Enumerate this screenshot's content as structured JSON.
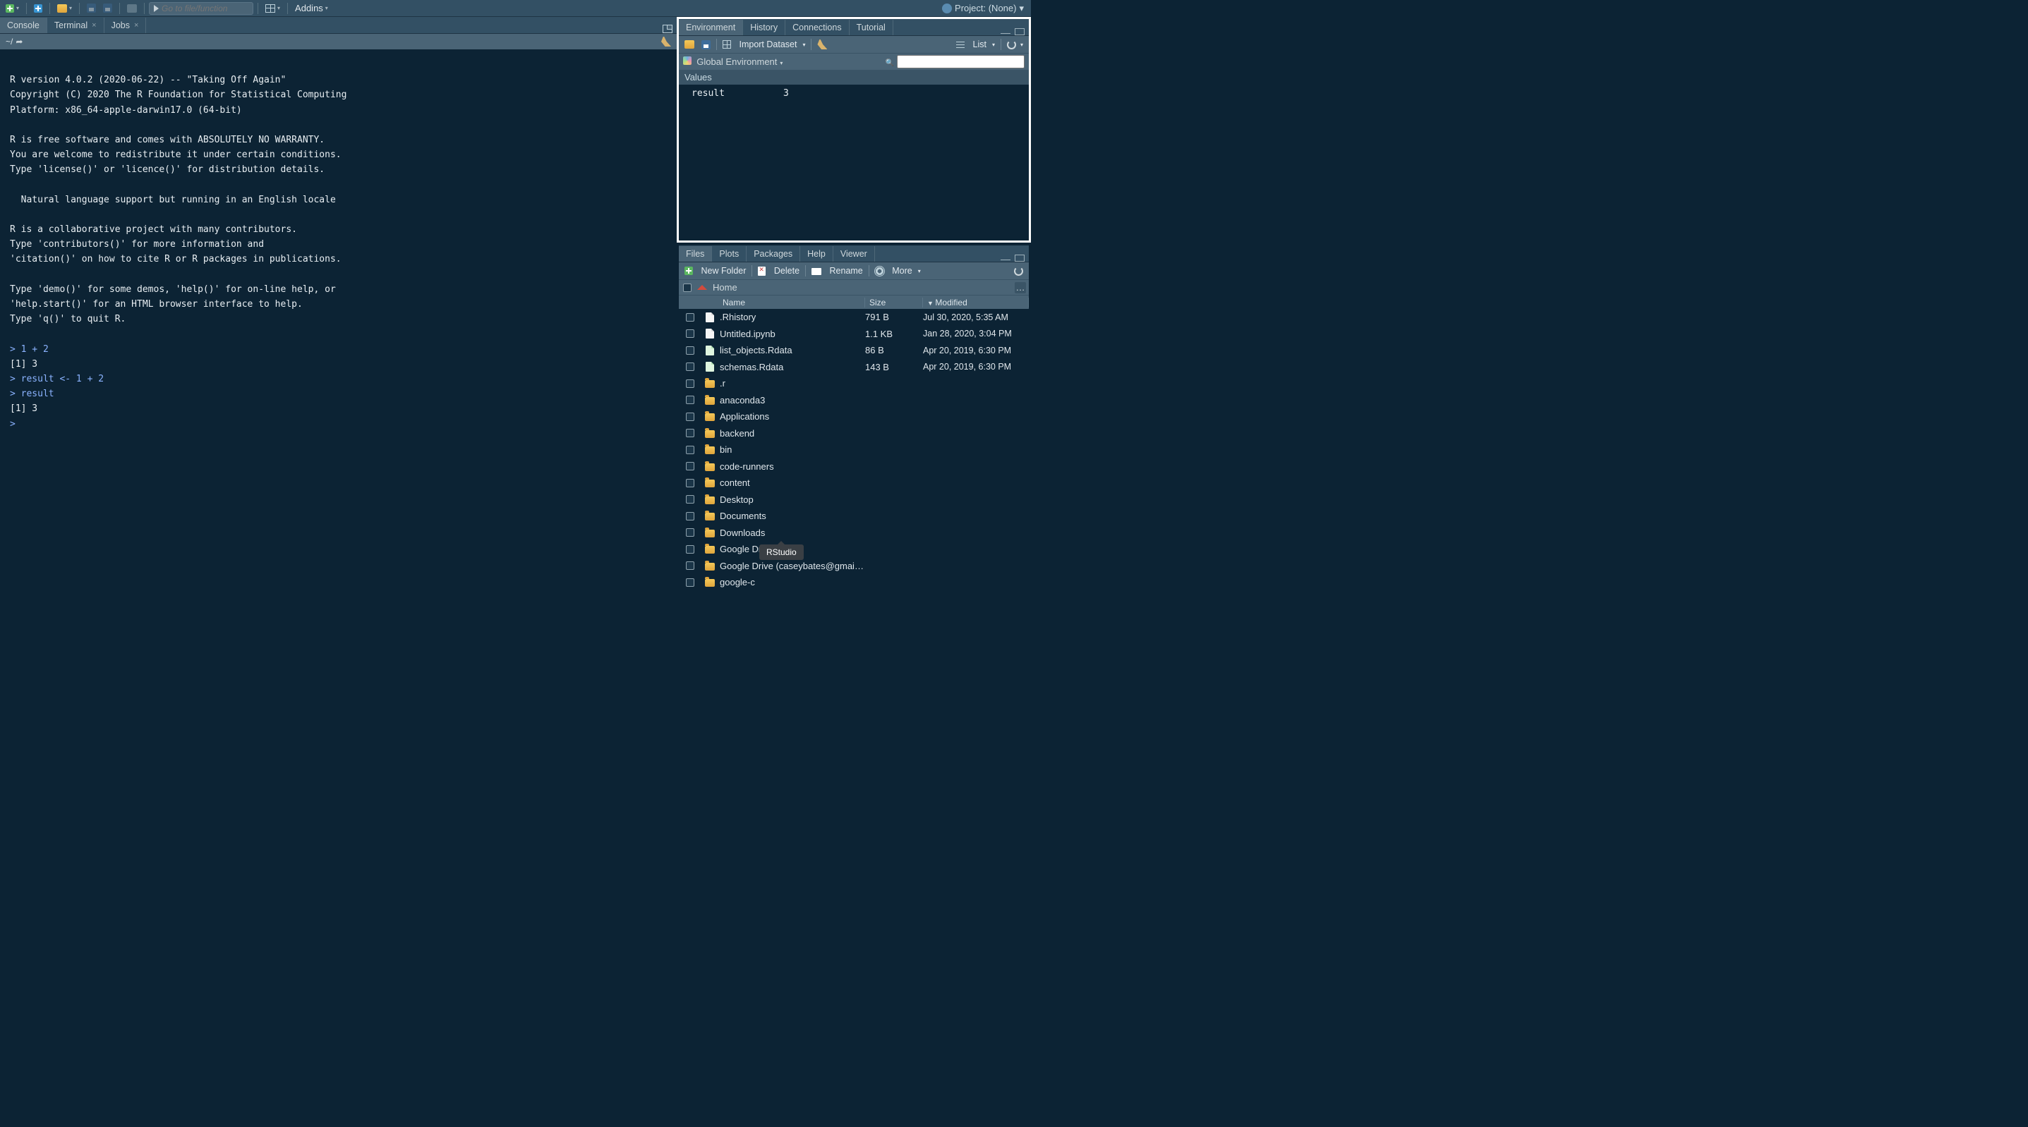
{
  "toolbar": {
    "goto_placeholder": "Go to file/function",
    "addins_label": "Addins",
    "project_label": "Project: (None)"
  },
  "left_tabs": [
    {
      "label": "Console",
      "closable": false,
      "active": true
    },
    {
      "label": "Terminal",
      "closable": true,
      "active": false
    },
    {
      "label": "Jobs",
      "closable": true,
      "active": false
    }
  ],
  "console": {
    "path": "~/",
    "lines": [
      {
        "t": "plain",
        "text": ""
      },
      {
        "t": "plain",
        "text": "R version 4.0.2 (2020-06-22) -- \"Taking Off Again\""
      },
      {
        "t": "plain",
        "text": "Copyright (C) 2020 The R Foundation for Statistical Computing"
      },
      {
        "t": "plain",
        "text": "Platform: x86_64-apple-darwin17.0 (64-bit)"
      },
      {
        "t": "plain",
        "text": ""
      },
      {
        "t": "plain",
        "text": "R is free software and comes with ABSOLUTELY NO WARRANTY."
      },
      {
        "t": "plain",
        "text": "You are welcome to redistribute it under certain conditions."
      },
      {
        "t": "plain",
        "text": "Type 'license()' or 'licence()' for distribution details."
      },
      {
        "t": "plain",
        "text": ""
      },
      {
        "t": "plain",
        "text": "  Natural language support but running in an English locale"
      },
      {
        "t": "plain",
        "text": ""
      },
      {
        "t": "plain",
        "text": "R is a collaborative project with many contributors."
      },
      {
        "t": "plain",
        "text": "Type 'contributors()' for more information and"
      },
      {
        "t": "plain",
        "text": "'citation()' on how to cite R or R packages in publications."
      },
      {
        "t": "plain",
        "text": ""
      },
      {
        "t": "plain",
        "text": "Type 'demo()' for some demos, 'help()' for on-line help, or"
      },
      {
        "t": "plain",
        "text": "'help.start()' for an HTML browser interface to help."
      },
      {
        "t": "plain",
        "text": "Type 'q()' to quit R."
      },
      {
        "t": "plain",
        "text": ""
      },
      {
        "t": "input",
        "text": "> 1 + 2"
      },
      {
        "t": "plain",
        "text": "[1] 3"
      },
      {
        "t": "input",
        "text": "> result <- 1 + 2"
      },
      {
        "t": "input",
        "text": "> result"
      },
      {
        "t": "plain",
        "text": "[1] 3"
      },
      {
        "t": "input",
        "text": "> "
      }
    ]
  },
  "env": {
    "tabs": [
      {
        "label": "Environment",
        "active": true
      },
      {
        "label": "History",
        "active": false
      },
      {
        "label": "Connections",
        "active": false
      },
      {
        "label": "Tutorial",
        "active": false
      }
    ],
    "toolbar": {
      "import_label": "Import Dataset",
      "view_label": "List"
    },
    "scope_label": "Global Environment",
    "section_label": "Values",
    "rows": [
      {
        "name": "result",
        "value": "3"
      }
    ]
  },
  "files": {
    "tabs": [
      {
        "label": "Files",
        "active": true
      },
      {
        "label": "Plots",
        "active": false
      },
      {
        "label": "Packages",
        "active": false
      },
      {
        "label": "Help",
        "active": false
      },
      {
        "label": "Viewer",
        "active": false
      }
    ],
    "toolbar": {
      "new_folder": "New Folder",
      "delete": "Delete",
      "rename": "Rename",
      "more": "More"
    },
    "breadcrumb": "Home",
    "columns": {
      "name": "Name",
      "size": "Size",
      "modified": "Modified"
    },
    "rows": [
      {
        "icon": "file",
        "name": ".Rhistory",
        "size": "791 B",
        "modified": "Jul 30, 2020, 5:35 AM"
      },
      {
        "icon": "file",
        "name": "Untitled.ipynb",
        "size": "1.1 KB",
        "modified": "Jan 28, 2020, 3:04 PM"
      },
      {
        "icon": "rdata",
        "name": "list_objects.Rdata",
        "size": "86 B",
        "modified": "Apr 20, 2019, 6:30 PM"
      },
      {
        "icon": "rdata",
        "name": "schemas.Rdata",
        "size": "143 B",
        "modified": "Apr 20, 2019, 6:30 PM"
      },
      {
        "icon": "folder",
        "name": ".r",
        "size": "",
        "modified": ""
      },
      {
        "icon": "folder",
        "name": "anaconda3",
        "size": "",
        "modified": ""
      },
      {
        "icon": "folder",
        "name": "Applications",
        "size": "",
        "modified": ""
      },
      {
        "icon": "folder",
        "name": "backend",
        "size": "",
        "modified": ""
      },
      {
        "icon": "folder",
        "name": "bin",
        "size": "",
        "modified": ""
      },
      {
        "icon": "folder",
        "name": "code-runners",
        "size": "",
        "modified": ""
      },
      {
        "icon": "folder",
        "name": "content",
        "size": "",
        "modified": ""
      },
      {
        "icon": "folder",
        "name": "Desktop",
        "size": "",
        "modified": ""
      },
      {
        "icon": "folder",
        "name": "Documents",
        "size": "",
        "modified": ""
      },
      {
        "icon": "folder",
        "name": "Downloads",
        "size": "",
        "modified": ""
      },
      {
        "icon": "folder",
        "name": "Google Drive",
        "size": "",
        "modified": ""
      },
      {
        "icon": "folder",
        "name": "Google Drive (caseybates@gmai…",
        "size": "",
        "modified": ""
      },
      {
        "icon": "folder",
        "name": "google-c",
        "size": "",
        "modified": ""
      }
    ]
  },
  "tooltip": "RStudio"
}
